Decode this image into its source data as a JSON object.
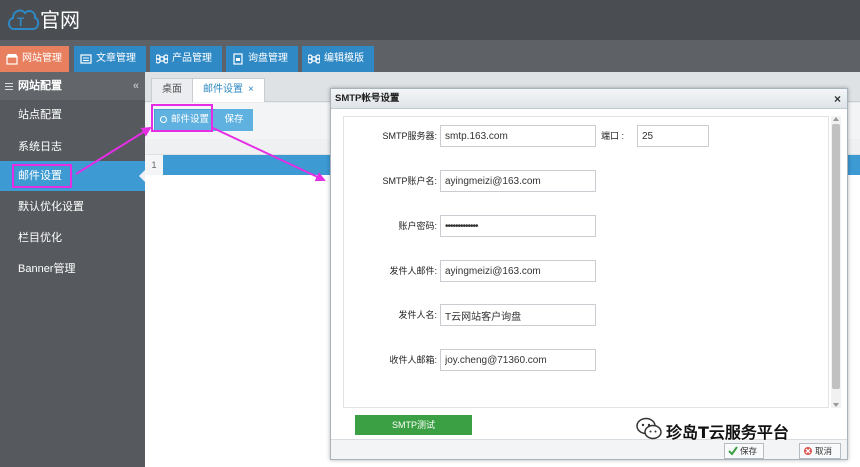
{
  "header": {
    "logo_text": "官网"
  },
  "topnav": {
    "tabs": [
      {
        "label": "网站管理",
        "icon": "store-icon"
      },
      {
        "label": "文章管理",
        "icon": "list-icon"
      },
      {
        "label": "产品管理",
        "icon": "command-icon"
      },
      {
        "label": "询盘管理",
        "icon": "box-icon"
      },
      {
        "label": "编辑模版",
        "icon": "command-icon"
      }
    ],
    "active_color": "#e87f5e",
    "tab_color": "#2f89c5"
  },
  "sidebar": {
    "section_title": "网站配置",
    "collapse_symbol": "«",
    "items": [
      {
        "label": "站点配置"
      },
      {
        "label": "系统日志"
      },
      {
        "label": "邮件设置"
      },
      {
        "label": "默认优化设置"
      },
      {
        "label": "栏目优化"
      },
      {
        "label": "Banner管理"
      }
    ],
    "active_index": 2
  },
  "page_tabs": [
    {
      "label": "桌面"
    },
    {
      "label": "邮件设置",
      "close": "×"
    }
  ],
  "toolbar": {
    "mail_settings_label": "邮件设置",
    "save_label": "保存"
  },
  "grid": {
    "row_number": "1",
    "selected_color": "#3d9ad3"
  },
  "dialog": {
    "title": "SMTP帐号设置",
    "close": "×",
    "fields": {
      "smtp_server": {
        "label": "SMTP服务器:",
        "value": "smtp.163.com"
      },
      "port": {
        "label": "端口 :",
        "value": "25"
      },
      "smtp_account": {
        "label": "SMTP账户名:",
        "value": "ayingmeizi@163.com"
      },
      "password": {
        "label": "账户密码:",
        "value": "•••••••••••••"
      },
      "sender_email": {
        "label": "发件人邮件:",
        "value": "ayingmeizi@163.com"
      },
      "sender_name": {
        "label": "发件人名:",
        "value": "T云网站客户询盘"
      },
      "recipient_email": {
        "label": "收件人邮箱:",
        "value": "joy.cheng@71360.com"
      }
    },
    "smtp_test_label": "SMTP测试",
    "footer": {
      "save_label": "保存",
      "cancel_label": "取消"
    }
  },
  "watermark": {
    "text": "珍岛T云服务平台"
  },
  "highlight_color": "#e52de6"
}
